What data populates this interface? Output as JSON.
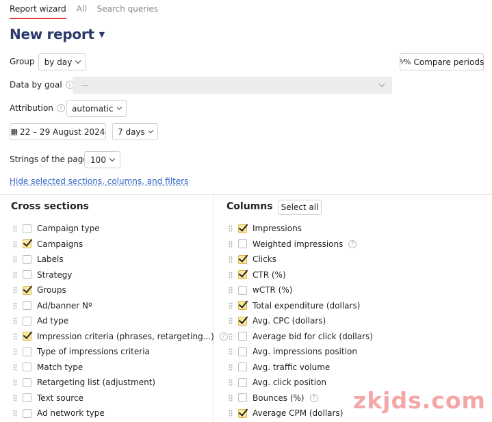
{
  "tabs": [
    {
      "label": "Report wizard",
      "active": true
    },
    {
      "label": "All",
      "active": false
    },
    {
      "label": "Search queries",
      "active": false
    }
  ],
  "title": "New report",
  "group": {
    "label": "Group",
    "value": "by day"
  },
  "compare_periods": "Compare periods",
  "goal": {
    "label": "Data by goal",
    "value": "—"
  },
  "attribution": {
    "label": "Attribution",
    "value": "automatic"
  },
  "date_range": "22 – 29 August 2024",
  "period": "7 days",
  "strings": {
    "label": "Strings of the page",
    "value": "100"
  },
  "hide_link": "Hide selected sections, columns, and filters",
  "cross_sections": {
    "title": "Cross sections",
    "items": [
      {
        "label": "Campaign type",
        "checked": false
      },
      {
        "label": "Campaigns",
        "checked": true
      },
      {
        "label": "Labels",
        "checked": false
      },
      {
        "label": "Strategy",
        "checked": false
      },
      {
        "label": "Groups",
        "checked": true
      },
      {
        "label": "Ad/banner Nº",
        "checked": false
      },
      {
        "label": "Ad type",
        "checked": false
      },
      {
        "label": "Impression criteria (phrases, retargeting...)",
        "checked": true,
        "help": true
      },
      {
        "label": "Type of impressions criteria",
        "checked": false
      },
      {
        "label": "Match type",
        "checked": false
      },
      {
        "label": "Retargeting list (adjustment)",
        "checked": false
      },
      {
        "label": "Text source",
        "checked": false
      },
      {
        "label": "Ad network type",
        "checked": false
      }
    ]
  },
  "columns": {
    "title": "Columns",
    "select_all": "Select all",
    "items": [
      {
        "label": "Impressions",
        "checked": true
      },
      {
        "label": "Weighted impressions",
        "checked": false,
        "help": true
      },
      {
        "label": "Clicks",
        "checked": true
      },
      {
        "label": "CTR (%)",
        "checked": true
      },
      {
        "label": "wCTR (%)",
        "checked": false
      },
      {
        "label": "Total expenditure (dollars)",
        "checked": true
      },
      {
        "label": "Avg. CPC (dollars)",
        "checked": true
      },
      {
        "label": "Average bid for click (dollars)",
        "checked": false
      },
      {
        "label": "Avg. impressions position",
        "checked": false
      },
      {
        "label": "Avg. traffic volume",
        "checked": false
      },
      {
        "label": "Avg. click position",
        "checked": false
      },
      {
        "label": "Bounces (%)",
        "checked": false,
        "help": true
      },
      {
        "label": "Average CPM (dollars)",
        "checked": true
      }
    ]
  },
  "watermark": "zkjds.com",
  "icons": {
    "help": "question-circle-icon",
    "calendar": "calendar-icon",
    "compare": "percent-icon",
    "caret": "caret-down-icon"
  }
}
